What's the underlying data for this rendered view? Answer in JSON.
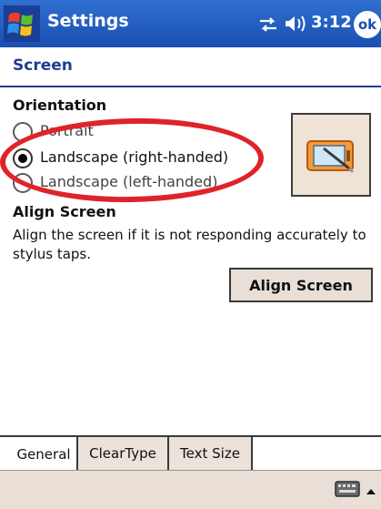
{
  "titlebar": {
    "title": "Settings",
    "time": "3:12",
    "ok_label": "ok",
    "icons": [
      "windows-start-icon",
      "connectivity-icon",
      "volume-icon"
    ]
  },
  "header": {
    "title": "Screen"
  },
  "orientation": {
    "heading": "Orientation",
    "options": [
      {
        "label": "Portrait",
        "selected": false
      },
      {
        "label": "Landscape (right-handed)",
        "selected": true
      },
      {
        "label": "Landscape (left-handed)",
        "selected": false
      }
    ],
    "picture_icon": "orientation-device-icon"
  },
  "align": {
    "heading": "Align Screen",
    "description": "Align the screen if it is not responding accurately to stylus taps.",
    "button_label": "Align Screen"
  },
  "tabs": [
    {
      "label": "General",
      "active": true
    },
    {
      "label": "ClearType",
      "active": false
    },
    {
      "label": "Text Size",
      "active": false
    }
  ],
  "bottombar": {
    "icons": [
      "keyboard-icon",
      "arrow-up-icon"
    ]
  },
  "colors": {
    "titlebar": "#1a4fb2",
    "header_text": "#1c3f8e",
    "highlight": "#e0232a",
    "button_face": "#e9dfd7"
  }
}
